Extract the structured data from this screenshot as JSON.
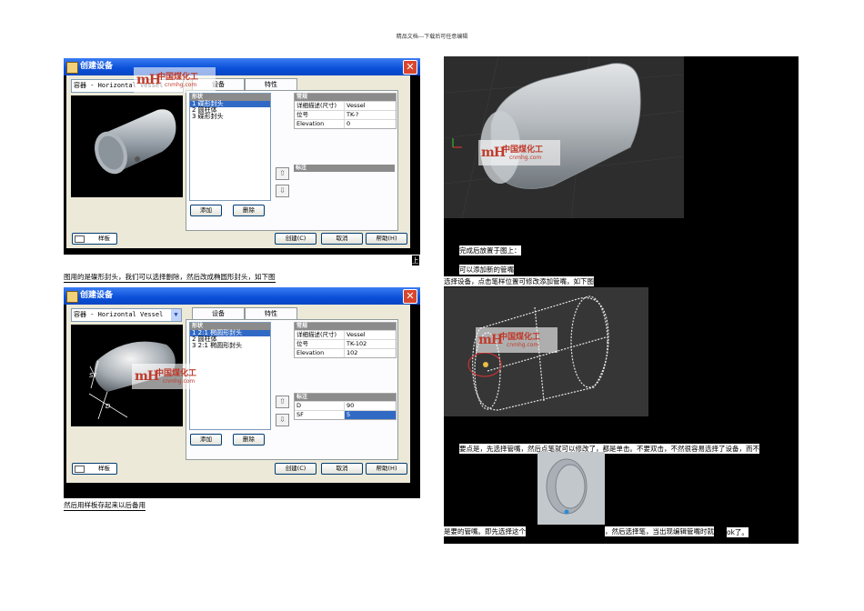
{
  "page_header": "精品文档---下载后可任意编辑",
  "watermark": {
    "logo": "mH",
    "name": "中国煤化工",
    "url": "cnmhg.com"
  },
  "dialog1": {
    "title": "创建设备",
    "combo": "容器 - Horizontal Vessel",
    "tabs": [
      "设备",
      "特性"
    ],
    "list_header": "形状",
    "list_items": [
      "1 碟形封头",
      "2 圆柱体",
      "3 碟形封头"
    ],
    "props_header": "常规",
    "props": [
      {
        "key": "详细描述(尺寸)",
        "value": "Vessel"
      },
      {
        "key": "位号",
        "value": "TK-?"
      },
      {
        "key": "Elevation",
        "value": "0"
      }
    ],
    "size_header": "标注",
    "add_button": "添加",
    "delete_button": "删除",
    "sample_button": "样板",
    "create_button": "创建(C)",
    "cancel_button": "取消",
    "help_button": "帮助(H)"
  },
  "dialog2": {
    "title": "创建设备",
    "combo": "容器 - Horizontal Vessel",
    "tabs": [
      "设备",
      "特性"
    ],
    "list_header": "形状",
    "list_items": [
      "1 2:1 椭圆形封头",
      "2 圆柱体",
      "3 2:1 椭圆形封头"
    ],
    "props_header": "常规",
    "props": [
      {
        "key": "详细描述(尺寸)",
        "value": "Vessel"
      },
      {
        "key": "位号",
        "value": "TK-102"
      },
      {
        "key": "Elevation",
        "value": "102"
      }
    ],
    "size_header": "标注",
    "size_props": [
      {
        "key": "D",
        "value": "90"
      },
      {
        "key": "SF",
        "value": "5"
      }
    ],
    "add_button": "添加",
    "delete_button": "删除",
    "sample_button": "样板",
    "create_button": "创建(C)",
    "cancel_button": "取消",
    "help_button": "帮助(H)"
  },
  "captions": {
    "up": "上",
    "c1": "图用的是碟形封头，我们可以选择删除，然后改成椭圆形封头，如下图",
    "c2": "然后用样板存起来以后备用",
    "r1": "完成后放置于图上：",
    "r2": "可以添加新的管嘴",
    "r3": "选择设备，点击笔样位置可修改添加管嘴，如下图",
    "r4": "要点是，先选择管嘴，然后点笔就可以修改了，都是单击。不要双击，不然很容易选择了设备，而不",
    "r5a": "是要的管嘴。即先选择这个",
    "r5b": "，然后选择笔，当出现编辑管嘴时就",
    "r5c": "ok了。"
  }
}
